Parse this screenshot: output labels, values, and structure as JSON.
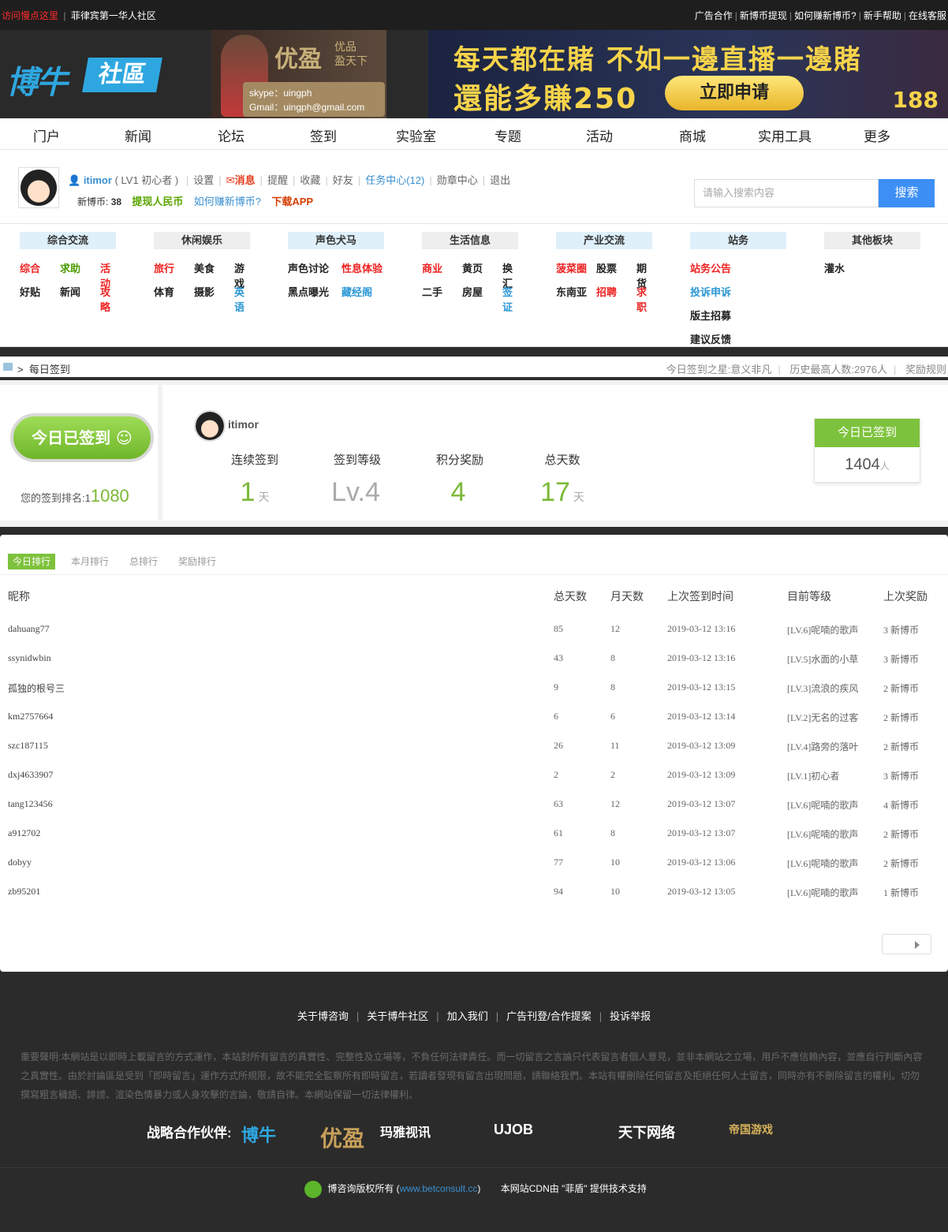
{
  "topbar": {
    "left_red": "访问慢点这里",
    "left_text": "菲律宾第一华人社区",
    "right": [
      "广告合作",
      "新博币提现",
      "如何赚新博币?",
      "新手帮助",
      "在线客服"
    ]
  },
  "banner": {
    "logo_a": "博牛",
    "logo_b": "社區",
    "ad1_brand": "优盈",
    "ad1_slogan": "优品 盈天下",
    "ad1_skype": "skype：uingph",
    "ad1_gmail": "Gmail：uingph@gmail.com",
    "ad2_line1": "每天都在賭 不如一邊直播一邊賭",
    "ad2_line2": "還能多賺250",
    "ad2_button": "立即申请",
    "ad2_badge": "188"
  },
  "nav": [
    "门户",
    "新闻",
    "论坛",
    "签到",
    "实验室",
    "专题",
    "活动",
    "商城",
    "实用工具",
    "更多"
  ],
  "user": {
    "name": "itimor",
    "level": "( LV1 初心者 )",
    "links": [
      "设置",
      "消息",
      "提醒",
      "收藏",
      "好友",
      "任务中心(12)",
      "勋章中心",
      "退出"
    ],
    "coins_label": "新博币:",
    "coins": "38",
    "withdraw": "提现人民币",
    "earn": "如何赚新博币?",
    "app": "下载APP"
  },
  "search": {
    "placeholder": "请输入搜索内容",
    "button": "搜索"
  },
  "forums": [
    {
      "title": "综合交流",
      "items": [
        [
          "综合",
          "red"
        ],
        [
          "求助",
          "green"
        ],
        [
          "活动",
          "red"
        ],
        [
          "好贴",
          ""
        ],
        [
          "新闻",
          ""
        ],
        [
          "攻略",
          "red"
        ]
      ]
    },
    {
      "title": "休闲娱乐",
      "items": [
        [
          "旅行",
          "red"
        ],
        [
          "美食",
          ""
        ],
        [
          "游戏",
          ""
        ],
        [
          "体育",
          ""
        ],
        [
          "摄影",
          ""
        ],
        [
          "英语",
          "blue"
        ]
      ]
    },
    {
      "title": "声色犬马",
      "items": [
        [
          "声色讨论",
          ""
        ],
        [
          "性息体验",
          "red"
        ],
        [
          "黑点曝光",
          ""
        ],
        [
          "藏经阁",
          "blue"
        ]
      ]
    },
    {
      "title": "生活信息",
      "items": [
        [
          "商业",
          "red"
        ],
        [
          "黄页",
          ""
        ],
        [
          "换汇",
          ""
        ],
        [
          "二手",
          ""
        ],
        [
          "房屋",
          ""
        ],
        [
          "签证",
          "blue"
        ]
      ]
    },
    {
      "title": "产业交流",
      "items": [
        [
          "菠菜圈",
          "red"
        ],
        [
          "股票",
          ""
        ],
        [
          "期货",
          ""
        ],
        [
          "东南亚",
          ""
        ],
        [
          "招聘",
          "red"
        ],
        [
          "求职",
          "red"
        ]
      ]
    },
    {
      "title": "站务",
      "items": [
        [
          "站务公告",
          "red"
        ],
        [
          "投诉申诉",
          "blue"
        ],
        [
          "版主招募",
          ""
        ],
        [
          "建议反馈",
          ""
        ]
      ]
    },
    {
      "title": "其他板块",
      "items": [
        [
          "灌水",
          ""
        ]
      ]
    }
  ],
  "crumb": {
    "current": "每日签到",
    "star": "今日签到之星:意义非凡",
    "max": "历史最高人数:2976人",
    "rules": "奖励规则"
  },
  "sign": {
    "button": "今日已签到 ☺",
    "rank_label": "您的签到排名:1",
    "rank": "1080",
    "name": "itimor",
    "stats": [
      {
        "label": "连续签到",
        "value": "1",
        "unit": "天"
      },
      {
        "label": "签到等级",
        "value": "Lv.4",
        "unit": ""
      },
      {
        "label": "积分奖励",
        "value": "4",
        "unit": ""
      },
      {
        "label": "总天数",
        "value": "17",
        "unit": "天"
      }
    ],
    "today_label": "今日已签到",
    "today_count": "1404",
    "today_unit": "人"
  },
  "tabs": [
    "今日排行",
    "本月排行",
    "总排行",
    "奖励排行"
  ],
  "table": {
    "headers": [
      "昵称",
      "总天数",
      "月天数",
      "上次签到时间",
      "目前等级",
      "上次奖励"
    ],
    "rows": [
      [
        "dahuang77",
        "85",
        "12",
        "2019-03-12 13:16",
        "[LV.6]呢喃的歌声",
        "3 新博币"
      ],
      [
        "ssynidwbin",
        "43",
        "8",
        "2019-03-12 13:16",
        "[LV.5]水面的小草",
        "3 新博币"
      ],
      [
        "孤独的根号三",
        "9",
        "8",
        "2019-03-12 13:15",
        "[LV.3]流浪的疾风",
        "2 新博币"
      ],
      [
        "km2757664",
        "6",
        "6",
        "2019-03-12 13:14",
        "[LV.2]无名的过客",
        "2 新博币"
      ],
      [
        "szc187115",
        "26",
        "11",
        "2019-03-12 13:09",
        "[LV.4]路旁的落叶",
        "2 新博币"
      ],
      [
        "dxj4633907",
        "2",
        "2",
        "2019-03-12 13:09",
        "[LV.1]初心者",
        "3 新博币"
      ],
      [
        "tang123456",
        "63",
        "12",
        "2019-03-12 13:07",
        "[LV.6]呢喃的歌声",
        "4 新博币"
      ],
      [
        "a912702",
        "61",
        "8",
        "2019-03-12 13:07",
        "[LV.6]呢喃的歌声",
        "2 新博币"
      ],
      [
        "dobyy",
        "77",
        "10",
        "2019-03-12 13:06",
        "[LV.6]呢喃的歌声",
        "2 新博币"
      ],
      [
        "zb95201",
        "94",
        "10",
        "2019-03-12 13:05",
        "[LV.6]呢喃的歌声",
        "1 新博币"
      ]
    ]
  },
  "footer": {
    "links": [
      "关于博咨询",
      "关于博牛社区",
      "加入我们",
      "广告刊登/合作提案",
      "投诉举报"
    ],
    "disclaimer": "重要聲明:本網站是以即時上載留言的方式運作，本站對所有留言的真實性、完整性及立場等，不負任何法律責任。而一切留言之言論只代表留言者個人意見，並非本網站之立場，用戶不應信賴內容，並應自行判斷內容之真實性。由於討論區是受到「即時留言」運作方式所規限，故不能完全監察所有即時留言，若讀者發現有留言出現問題，請聯絡我們。本站有權刪除任何留言及拒絕任何人士留言，同時亦有不刪除留言的權利。切勿撰寫粗言穢語、誹謗、渲染色情暴力或人身攻擊的言論，敬請自律。本網站保留一切法律權利。",
    "partners_label": "战略合作伙伴:",
    "partners": [
      "博牛",
      "优盈",
      "玛雅视讯",
      "UJOB",
      "天下网络",
      "帝国游戏"
    ],
    "copyright": "博咨询版权所有 (",
    "url": "www.betconsult.cc",
    "copyright_end": ")",
    "cdn": "本网站CDN由 \"菲盾\" 提供技术支持"
  }
}
